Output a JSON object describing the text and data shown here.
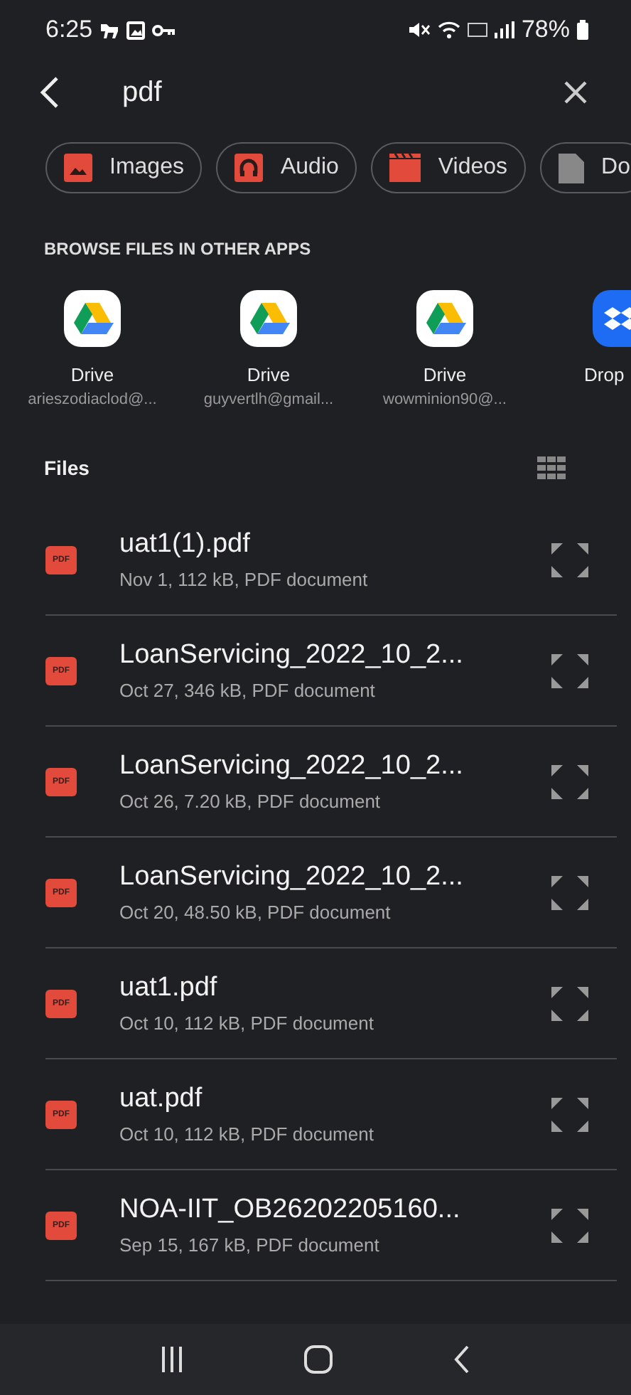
{
  "status_bar": {
    "time": "6:25",
    "battery": "78%"
  },
  "search": {
    "value": "pdf"
  },
  "chips": [
    {
      "kind": "image",
      "label": "Images"
    },
    {
      "kind": "audio",
      "label": "Audio"
    },
    {
      "kind": "video",
      "label": "Videos"
    },
    {
      "kind": "document",
      "label": "Do"
    }
  ],
  "other_apps": {
    "title": "BROWSE FILES IN OTHER APPS",
    "apps": [
      {
        "kind": "drive",
        "name": "Drive",
        "account": "arieszodiaclod@..."
      },
      {
        "kind": "drive",
        "name": "Drive",
        "account": "guyvertlh@gmail..."
      },
      {
        "kind": "drive",
        "name": "Drive",
        "account": "wowminion90@..."
      },
      {
        "kind": "dropbox",
        "name": "Drop"
      }
    ]
  },
  "files": {
    "title": "Files",
    "items": [
      {
        "name": "uat1(1).pdf",
        "meta": "Nov 1, 112 kB, PDF document",
        "icon": "PDF"
      },
      {
        "name": "LoanServicing_2022_10_2...",
        "meta": "Oct 27, 346 kB, PDF document",
        "icon": "PDF"
      },
      {
        "name": "LoanServicing_2022_10_2...",
        "meta": "Oct 26, 7.20 kB, PDF document",
        "icon": "PDF"
      },
      {
        "name": "LoanServicing_2022_10_2...",
        "meta": "Oct 20, 48.50 kB, PDF document",
        "icon": "PDF"
      },
      {
        "name": "uat1.pdf",
        "meta": "Oct 10, 112 kB, PDF document",
        "icon": "PDF"
      },
      {
        "name": "uat.pdf",
        "meta": "Oct 10, 112 kB, PDF document",
        "icon": "PDF"
      },
      {
        "name": "NOA-IIT_OB26202205160...",
        "meta": "Sep 15, 167 kB, PDF document",
        "icon": "PDF"
      }
    ]
  }
}
